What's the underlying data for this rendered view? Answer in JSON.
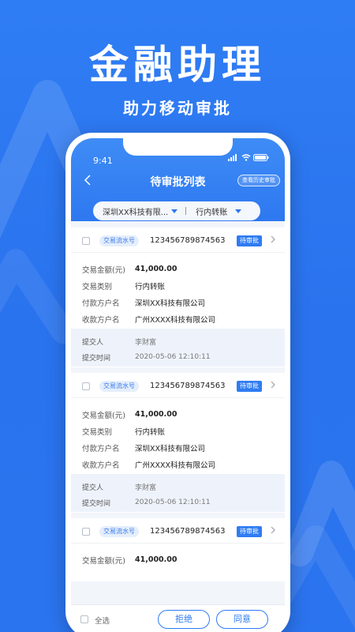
{
  "hero": {
    "title": "金融助理",
    "subtitle": "助力移动审批"
  },
  "status_bar": {
    "time": "9:41"
  },
  "nav": {
    "back_icon": "chevron-left-icon",
    "title": "待审批列表",
    "history_button": "查看历史审批"
  },
  "filters": [
    {
      "label": "深圳XX科技有限..."
    },
    {
      "label": "行内转账"
    }
  ],
  "colors": {
    "primary": "#2f7cf2",
    "tag_bg": "#e5eefc",
    "footer_bg": "#eef3fb"
  },
  "cards": [
    {
      "serial_tag": "交易流水号",
      "serial_no": "123456789874563",
      "status": "待审批",
      "fields": [
        {
          "label": "交易金额(元)",
          "value": "41,000.00"
        },
        {
          "label": "交易类别",
          "value": "行内转账"
        },
        {
          "label": "付款方户名",
          "value": "深圳XX科技有限公司"
        },
        {
          "label": "收款方户名",
          "value": "广州XXXX科技有限公司"
        }
      ],
      "submitter_label": "提交人",
      "submitter": "李财富",
      "time_label": "提交时间",
      "time": "2020-05-06 12:10:11"
    },
    {
      "serial_tag": "交易流水号",
      "serial_no": "123456789874563",
      "status": "待审批",
      "fields": [
        {
          "label": "交易金额(元)",
          "value": "41,000.00"
        },
        {
          "label": "交易类别",
          "value": "行内转账"
        },
        {
          "label": "付款方户名",
          "value": "深圳XX科技有限公司"
        },
        {
          "label": "收款方户名",
          "value": "广州XXXX科技有限公司"
        }
      ],
      "submitter_label": "提交人",
      "submitter": "李财富",
      "time_label": "提交时间",
      "time": "2020-05-06 12:10:11"
    },
    {
      "serial_tag": "交易流水号",
      "serial_no": "123456789874563",
      "status": "待审批",
      "fields": [
        {
          "label": "交易金额(元)",
          "value": "41,000.00"
        }
      ]
    }
  ],
  "bottom_bar": {
    "select_all": "全选",
    "reject": "拒绝",
    "agree": "同意"
  }
}
